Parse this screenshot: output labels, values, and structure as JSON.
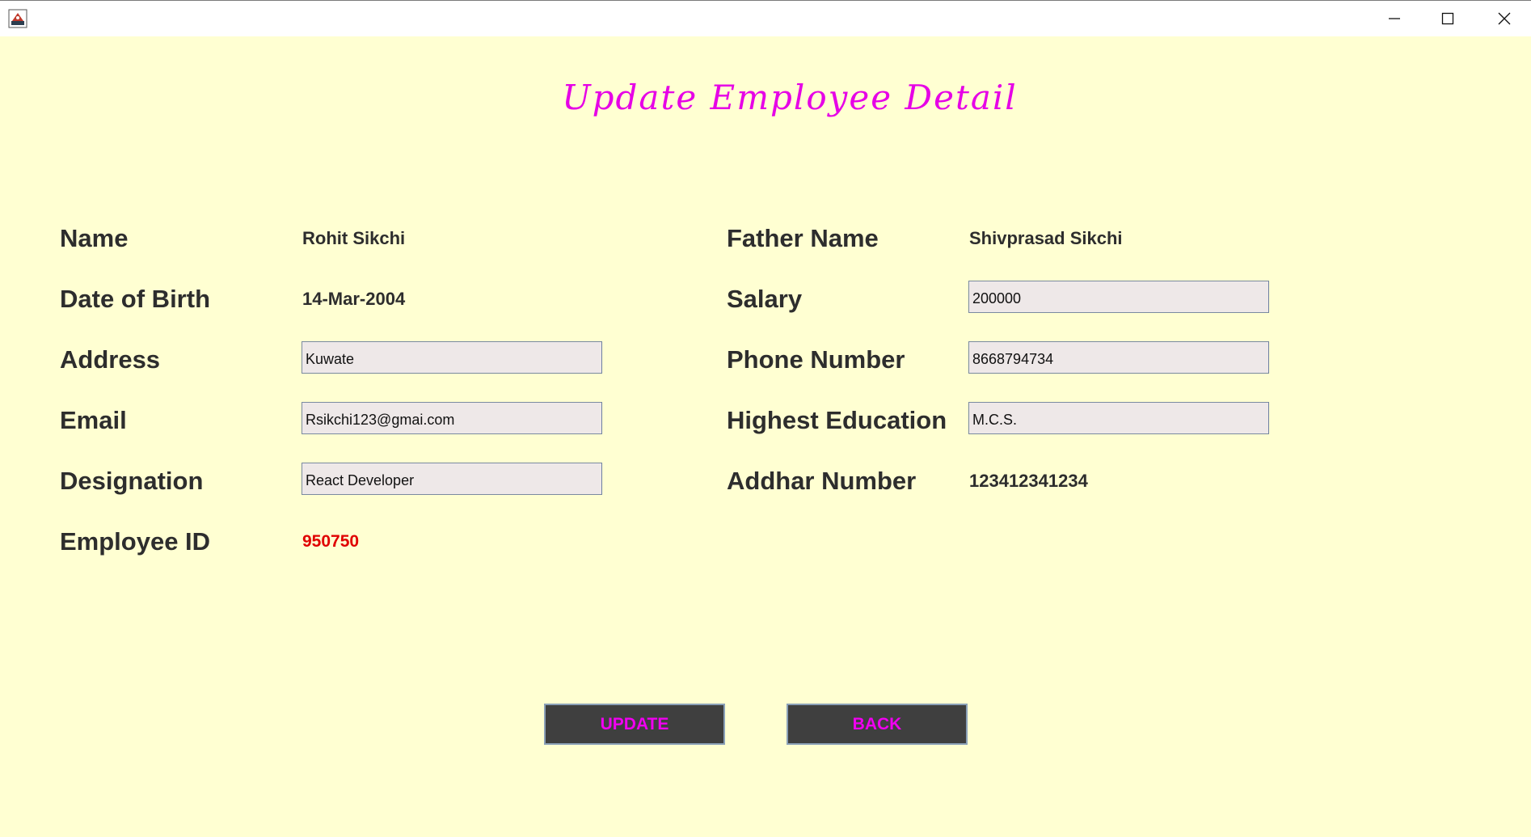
{
  "window": {
    "icon": "java-app-icon",
    "controls": [
      "minimize-icon",
      "maximize-icon",
      "close-icon"
    ]
  },
  "heading": "Update Employee Detail",
  "form": {
    "name_label": "Name",
    "name_value": "Rohit Sikchi",
    "father_label": "Father Name",
    "father_value": "Shivprasad Sikchi",
    "dob_label": "Date of Birth",
    "dob_value": "14-Mar-2004",
    "salary_label": "Salary",
    "salary_value": "200000",
    "address_label": "Address",
    "address_value": "Kuwate",
    "phone_label": "Phone Number",
    "phone_value": "8668794734",
    "email_label": "Email",
    "email_value": "Rsikchi123@gmai.com",
    "education_label": "Highest Education",
    "education_value": "M.C.S.",
    "designation_label": "Designation",
    "designation_value": "React Developer",
    "aadhar_label": "Addhar Number",
    "aadhar_value": "123412341234",
    "empid_label": "Employee ID",
    "empid_value": "950750"
  },
  "buttons": {
    "update": "UPDATE",
    "back": "BACK"
  },
  "colors": {
    "background": "#ffffd2",
    "heading": "#e600e6",
    "button_bg": "#3f3f3f",
    "button_text": "#f000f0",
    "employee_id": "#e00000"
  }
}
